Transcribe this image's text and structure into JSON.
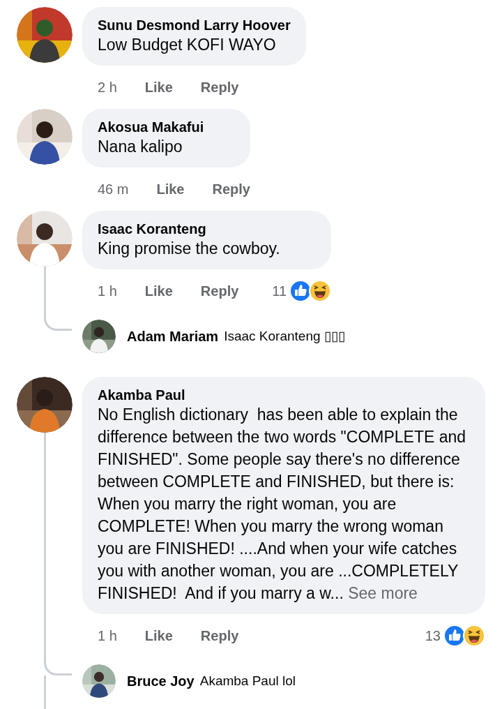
{
  "comments": [
    {
      "author": "Sunu Desmond Larry Hoover",
      "text": "Low Budget KOFI WAYO",
      "time": "2 h",
      "like": "Like",
      "reply": "Reply"
    },
    {
      "author": "Akosua Makafui",
      "text": "Nana kalipo",
      "time": "46 m",
      "like": "Like",
      "reply": "Reply"
    },
    {
      "author": "Isaac Koranteng",
      "text": "King promise the cowboy.",
      "time": "1 h",
      "like": "Like",
      "reply": "Reply",
      "reaction_count": "11",
      "reactions": [
        {
          "kind": "like"
        },
        {
          "kind": "haha"
        }
      ],
      "thread_continues": false,
      "replies": [
        {
          "author": "Adam Mariam",
          "text": "Isaac Koranteng ▯▯▯"
        }
      ]
    },
    {
      "author": "Akamba Paul",
      "text": "No English dictionary  has been able to explain the difference between the two words \"COMPLETE and FINISHED\". Some people say there's no difference between COMPLETE and FINISHED, but there is: When you marry the right woman, you are COMPLETE! When you marry the wrong woman you are FINISHED! ....And when your wife catches you with another woman, you are ...COMPLETELY FINISHED!  And if you marry a w...",
      "see_more": "See more",
      "time": "1 h",
      "like": "Like",
      "reply": "Reply",
      "reaction_count": "13",
      "reactions": [
        {
          "kind": "like"
        },
        {
          "kind": "haha"
        }
      ],
      "thread_continues": true,
      "replies": [
        {
          "author": "Bruce Joy",
          "text": "Akamba Paul lol"
        }
      ]
    }
  ]
}
